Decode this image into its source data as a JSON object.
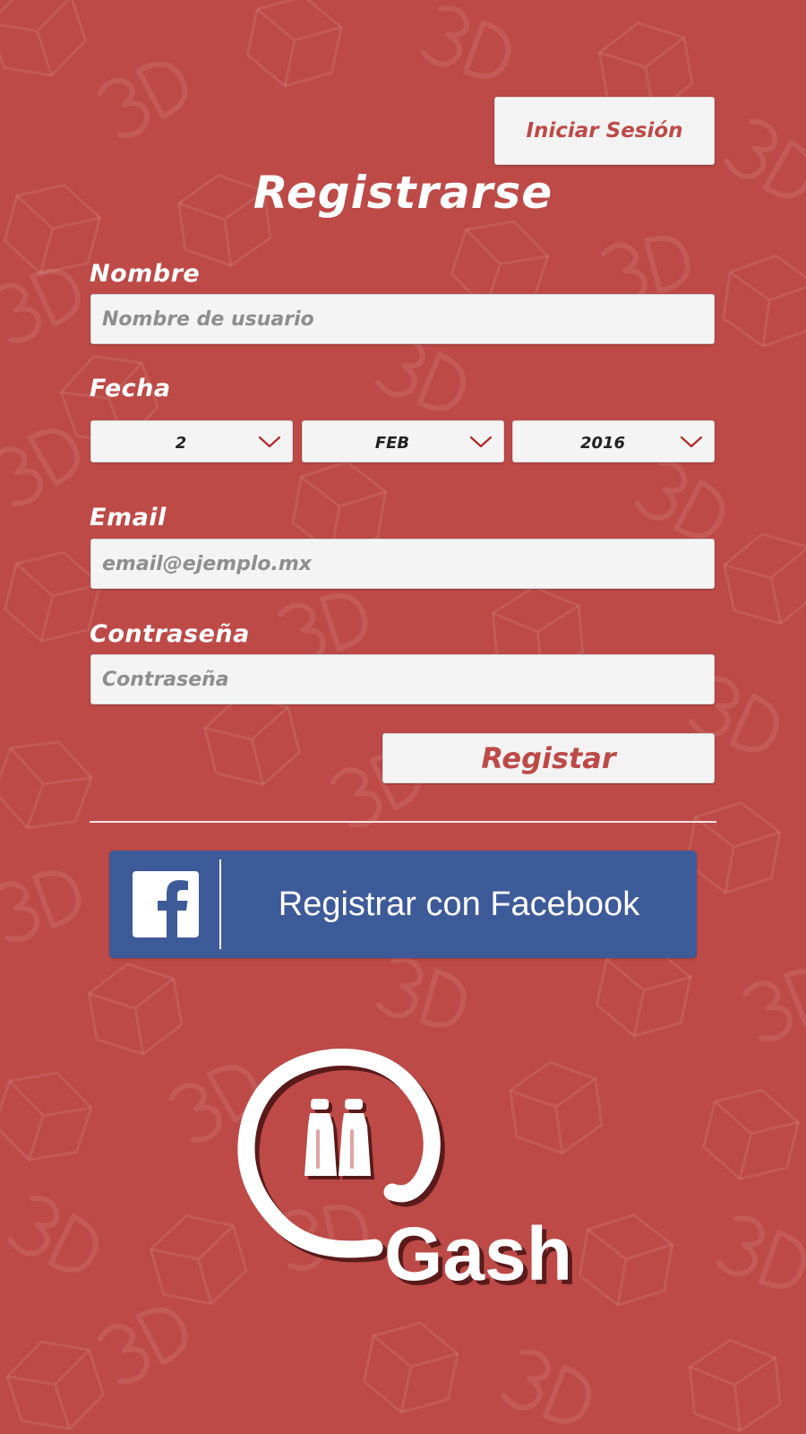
{
  "header": {
    "login_label": "Iniciar Sesión"
  },
  "page": {
    "title": "Registrarse"
  },
  "form": {
    "name": {
      "label": "Nombre",
      "placeholder": "Nombre de usuario",
      "value": ""
    },
    "date": {
      "label": "Fecha",
      "day": "2",
      "month": "FEB",
      "year": "2016"
    },
    "email": {
      "label": "Email",
      "placeholder": "email@ejemplo.mx",
      "value": ""
    },
    "password": {
      "label": "Contraseña",
      "placeholder": "Contraseña",
      "value": ""
    },
    "submit_label": "Registar"
  },
  "facebook": {
    "label": "Registrar con Facebook"
  },
  "logo": {
    "brand_text": "Gash",
    "alt": "@Gash logo"
  },
  "colors": {
    "background": "#bd4a47",
    "accent_text": "#bd4a47",
    "facebook_blue": "#3d5a99",
    "field_bg": "#f4f4f4",
    "chevron": "#b02a2a"
  },
  "icons": {
    "chevron": "chevron-down-icon",
    "facebook": "facebook-icon"
  }
}
